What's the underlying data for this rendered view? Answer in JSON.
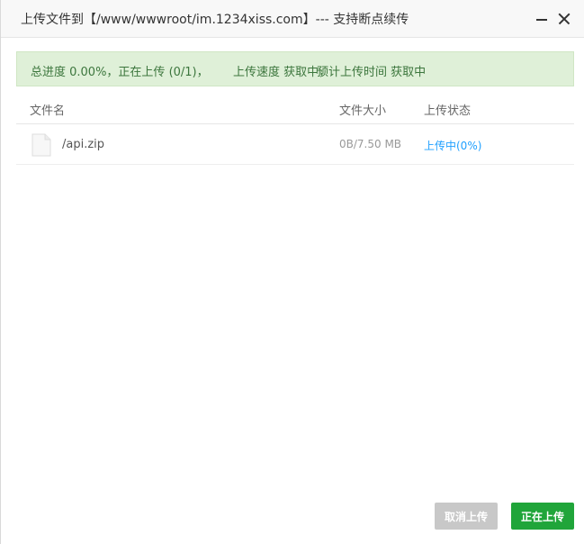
{
  "window": {
    "title": "上传文件到【/www/wwwroot/im.1234xiss.com】--- 支持断点续传"
  },
  "progress": {
    "total": "总进度 0.00%，正在上传 (0/1)，",
    "speed": "上传速度 获取中，",
    "eta": "预计上传时间 获取中"
  },
  "table": {
    "headers": {
      "name": "文件名",
      "size": "文件大小",
      "status": "上传状态"
    },
    "rows": [
      {
        "icon": "file-icon",
        "name": "/api.zip",
        "size": "0B/7.50 MB",
        "status": "上传中(0%)"
      }
    ]
  },
  "buttons": {
    "cancel": "取消上传",
    "upload": "正在上传"
  },
  "colors": {
    "banner_bg": "#dff0d8",
    "banner_text": "#3c763d",
    "status_blue": "#20a0ff",
    "upload_green": "#20a53a",
    "cancel_gray": "#c8c8c8"
  }
}
